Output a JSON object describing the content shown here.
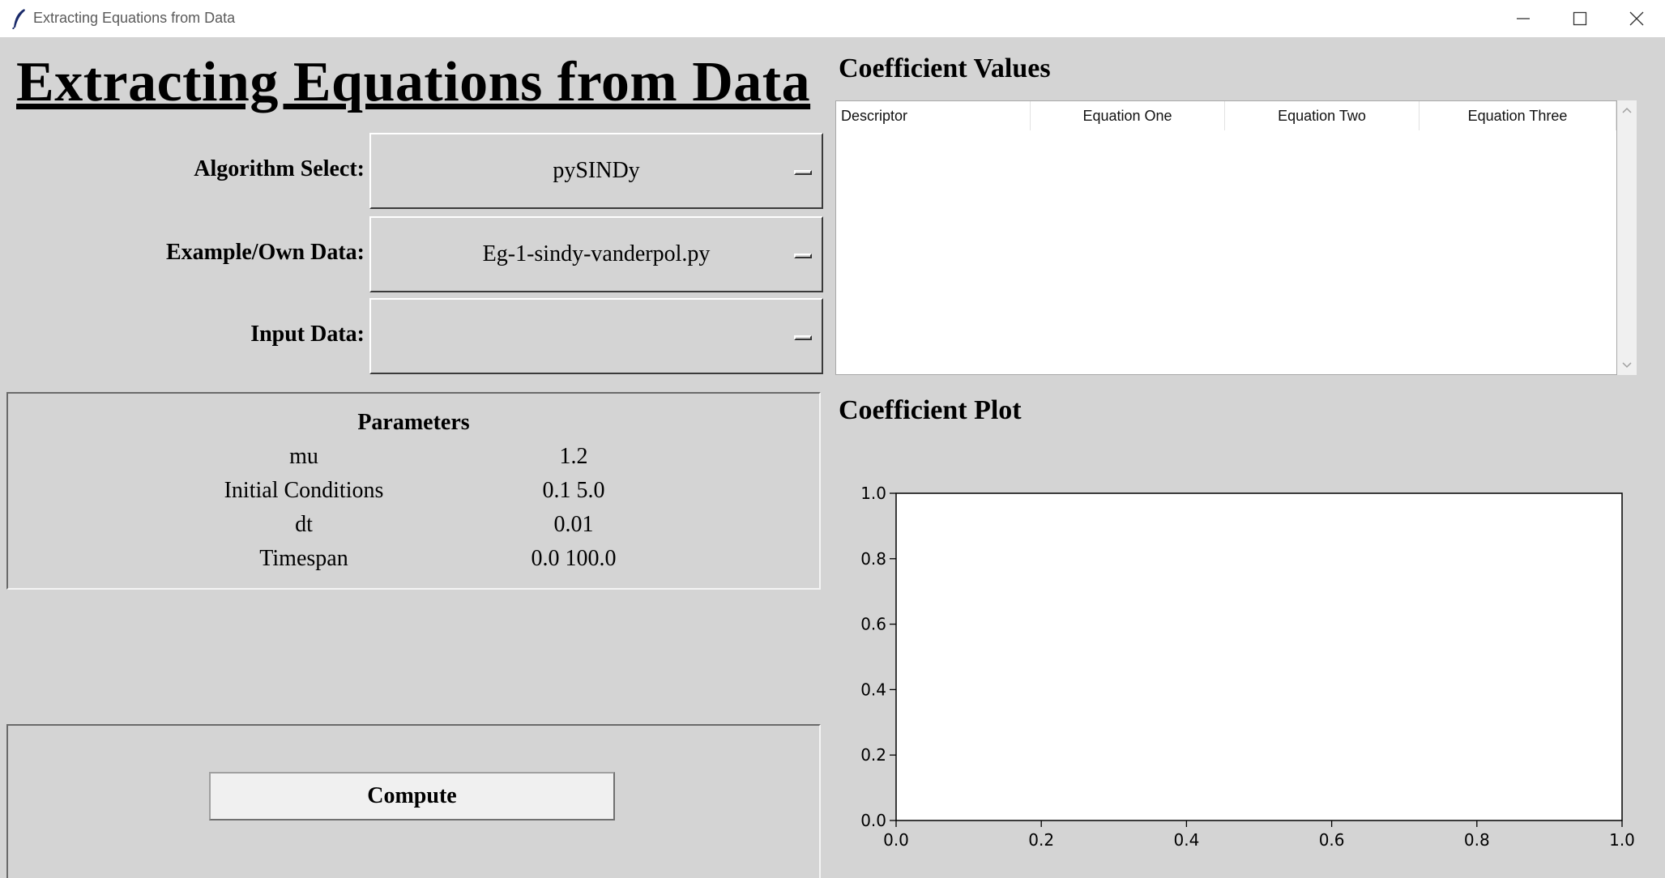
{
  "window": {
    "title": "Extracting Equations from Data",
    "icons": {
      "app": "feather-icon",
      "minimize": "minimize-icon",
      "maximize": "maximize-icon",
      "close": "close-icon"
    }
  },
  "heading": "Extracting Equations from Data",
  "controls": {
    "algorithm": {
      "label": "Algorithm Select:",
      "value": "pySINDy"
    },
    "example": {
      "label": "Example/Own Data:",
      "value": "Eg-1-sindy-vanderpol.py"
    },
    "input_data": {
      "label": "Input Data:",
      "value": ""
    }
  },
  "parameters": {
    "title": "Parameters",
    "rows": [
      {
        "name": "mu",
        "value": "1.2"
      },
      {
        "name": "Initial Conditions",
        "value": "0.1 5.0"
      },
      {
        "name": "dt",
        "value": "0.01"
      },
      {
        "name": "Timespan",
        "value": "0.0 100.0"
      }
    ]
  },
  "compute_label": "Compute",
  "coefficients": {
    "title": "Coefficient Values",
    "columns": [
      "Descriptor",
      "Equation One",
      "Equation Two",
      "Equation Three"
    ],
    "rows": []
  },
  "plot": {
    "title": "Coefficient Plot"
  },
  "chart_data": {
    "type": "line",
    "series": [],
    "xlim": [
      0.0,
      1.0
    ],
    "ylim": [
      0.0,
      1.0
    ],
    "xticks": [
      "0.0",
      "0.2",
      "0.4",
      "0.6",
      "0.8",
      "1.0"
    ],
    "yticks": [
      "0.0",
      "0.2",
      "0.4",
      "0.6",
      "0.8",
      "1.0"
    ],
    "grid": false
  }
}
